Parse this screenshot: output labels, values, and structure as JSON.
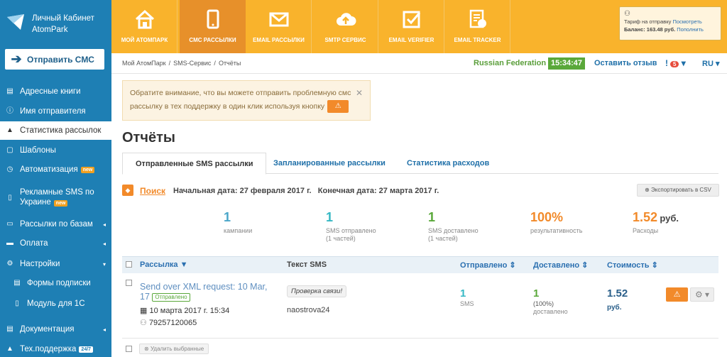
{
  "brand": {
    "line1": "Личный Кабинет",
    "line2": "AtomPark"
  },
  "send_button": "Отправить СМС",
  "sidebar": {
    "items": [
      {
        "label": "Адресные книги",
        "icon": "book-icon"
      },
      {
        "label": "Имя отправителя",
        "icon": "info-icon"
      },
      {
        "label": "Статистика рассылок",
        "icon": "chart-icon",
        "active": true
      },
      {
        "label": "Шаблоны",
        "icon": "template-icon"
      },
      {
        "label": "Автоматизация",
        "icon": "clock-icon",
        "badge": "new"
      },
      {
        "label": "Рекламные SMS по",
        "label2": "Украине",
        "icon": "phone-icon",
        "badge": "new"
      },
      {
        "label": "Рассылки по базам",
        "icon": "folder-icon"
      },
      {
        "label": "Оплата",
        "icon": "card-icon"
      },
      {
        "label": "Настройки",
        "icon": "settings-icon"
      },
      {
        "label": "Формы подписки",
        "icon": "form-icon"
      },
      {
        "label": "Модуль для 1С",
        "icon": "file-icon"
      },
      {
        "label": "Документация",
        "icon": "doc-icon"
      },
      {
        "label": "Тех.поддержка",
        "icon": "support-icon",
        "badge": "24/7"
      }
    ]
  },
  "topnav": {
    "tabs": [
      "МОЙ АТОМПАРК",
      "СМС РАССЫЛКИ",
      "EMAIL РАССЫЛКИ",
      "SMTP СЕРВИС",
      "EMAIL VERIFIER",
      "EMAIL TRACKER"
    ],
    "active": 1
  },
  "tariff": {
    "line1": "Тариф на отправку",
    "line1_link": "Посмотреть",
    "line2": "Баланс: 163.48 руб.",
    "line2_link": "Пополнить"
  },
  "breadcrumb": [
    "Мой АтомПарк",
    "SMS-Сервис",
    "Отчёты"
  ],
  "header": {
    "region": "Russian Federation",
    "time": "15:34:47",
    "feedback": "Оставить отзыв",
    "notifications": "5",
    "lang": "RU"
  },
  "notice": {
    "line1": "Обратите внимание, что вы можете отправить проблемную смс",
    "line2": "рассылку в тех поддержку в один клик используя кнопку"
  },
  "page_title": "Отчёты",
  "tabs": [
    "Отправленные SMS рассылки",
    "Запланированные рассылки",
    "Статистика расходов"
  ],
  "search": {
    "label": "Поиск",
    "start": "Начальная дата: 27 февраля 2017 г.",
    "end": "Конечная дата: 27 марта 2017 г.",
    "export": "Экспортировать в CSV"
  },
  "stats": [
    {
      "value": "1",
      "label": "кампании",
      "label2": ""
    },
    {
      "value": "1",
      "label": "SMS отправлено",
      "label2": "(1 частей)"
    },
    {
      "value": "1",
      "label": "SMS доставлено",
      "label2": "(1 частей)"
    },
    {
      "value": "100%",
      "label": "результативность",
      "label2": ""
    },
    {
      "value": "1.52",
      "unit": "руб.",
      "label": "Расходы",
      "label2": ""
    }
  ],
  "table": {
    "headers": [
      "Рассылка",
      "Текст SMS",
      "Отправлено",
      "Доставлено",
      "Стоимость"
    ],
    "rows": [
      {
        "title": "Send over XML request: 10 Mar, 17",
        "status": "Отправлено",
        "date": "10 марта 2017 г. 15:34",
        "phone": "79257120065",
        "text": "Проверка связи!",
        "sender": "naostrova24",
        "sent": "1",
        "sent_unit": "SMS",
        "delivered": "1",
        "delivered_pct": "(100%)",
        "delivered_label": "доставлено",
        "cost": "1.52",
        "cost_unit": "руб."
      }
    ]
  },
  "delete_selected": "Удалить выбранные"
}
